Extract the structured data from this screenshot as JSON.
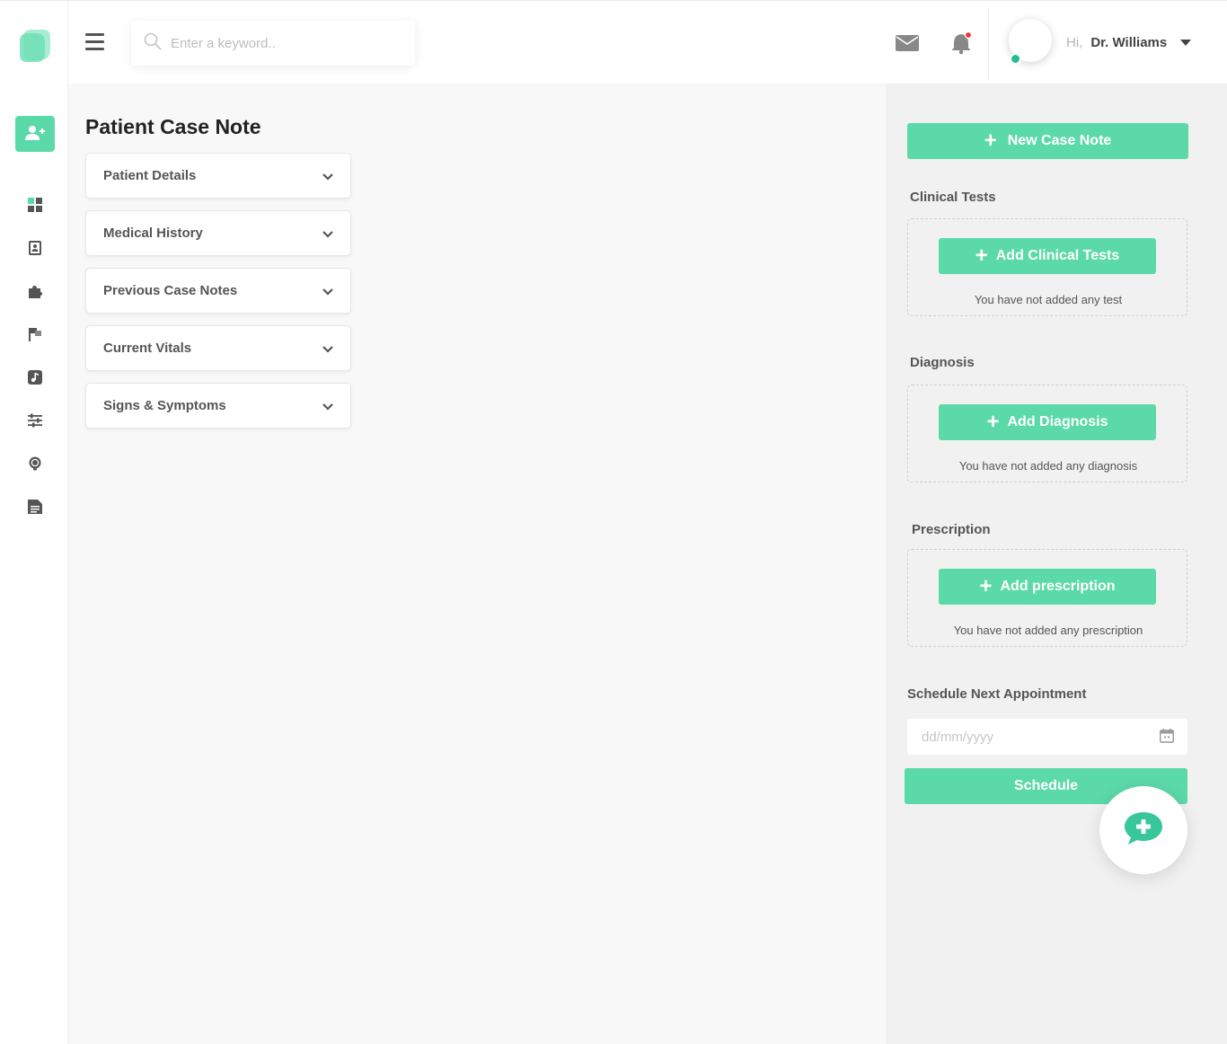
{
  "search": {
    "placeholder": "Enter a keyword.."
  },
  "user": {
    "greeting": "Hi,",
    "name": "Dr. Williams"
  },
  "page": {
    "title": "Patient Case Note"
  },
  "accordions": [
    {
      "label": "Patient Details"
    },
    {
      "label": "Medical History"
    },
    {
      "label": "Previous Case Notes"
    },
    {
      "label": "Current Vitals"
    },
    {
      "label": "Signs & Symptoms"
    }
  ],
  "right_panel": {
    "new_case_note_label": "New Case Note",
    "clinical_tests": {
      "title": "Clinical Tests",
      "button_label": "Add Clinical Tests",
      "empty_text": "You have not added any test"
    },
    "diagnosis": {
      "title": "Diagnosis",
      "button_label": "Add Diagnosis",
      "empty_text": "You have not added any diagnosis"
    },
    "prescription": {
      "title": "Prescription",
      "button_label": "Add prescription",
      "empty_text": "You have not added any prescription"
    },
    "schedule": {
      "title": "Schedule Next Appointment",
      "date_placeholder": "dd/mm/yyyy",
      "button_label": "Schedule"
    }
  },
  "colors": {
    "accent": "#5cd9a9",
    "status_online": "#1fbf95",
    "notification_dot": "#e53935"
  }
}
